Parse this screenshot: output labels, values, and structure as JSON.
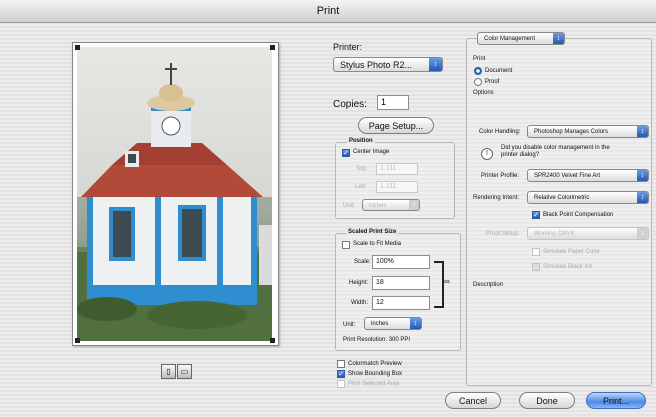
{
  "window": {
    "title": "Print"
  },
  "printer": {
    "label": "Printer:",
    "value": "Stylus Photo R2..."
  },
  "copies": {
    "label": "Copies:",
    "value": "1"
  },
  "page_setup_button": "Page Setup...",
  "position": {
    "title": "Position",
    "center_image": "Center Image",
    "top_label": "Top:",
    "top_value": "1.111",
    "left_label": "Left:",
    "left_value": "1.111",
    "unit_label": "Unit:",
    "unit_value": "inches"
  },
  "scaled": {
    "title": "Scaled Print Size",
    "scale_to_fit": "Scale to Fit Media",
    "scale_label": "Scale:",
    "scale_value": "100%",
    "height_label": "Height:",
    "height_value": "18",
    "width_label": "Width:",
    "width_value": "12",
    "unit_label": "Unit:",
    "unit_value": "inches",
    "resolution": "Print Resolution: 300 PPI"
  },
  "options": {
    "colormatch": "Colormatch Preview",
    "show_bounding_box": "Show Bounding Box",
    "print_selected_area": "Print Selected Area"
  },
  "color_mgmt": {
    "section": "Color Management",
    "print_label": "Print",
    "document": "Document",
    "proof": "Proof",
    "options_label": "Options",
    "color_handling_label": "Color Handling:",
    "color_handling_value": "Photoshop Manages Colors",
    "notice": "Did you disable color management in the printer dialog?",
    "printer_profile_label": "Printer Profile:",
    "printer_profile_value": "SPR2400 Velvet Fine Art",
    "rendering_intent_label": "Rendering Intent:",
    "rendering_intent_value": "Relative Colorimetric",
    "black_point": "Black Point Compensation",
    "proof_setup_label": "Proof Setup:",
    "proof_setup_value": "Working CMYK",
    "simulate_paper": "Simulate Paper Color",
    "simulate_black": "Simulate Black Ink",
    "description_label": "Description"
  },
  "buttons": {
    "cancel": "Cancel",
    "done": "Done",
    "print": "Print..."
  },
  "colors": {
    "accent": "#2f6bd6",
    "sky": "#dcdcd8",
    "wall": "#f2f3f3",
    "trim": "#2f8ed0",
    "roof": "#b24a3a"
  }
}
